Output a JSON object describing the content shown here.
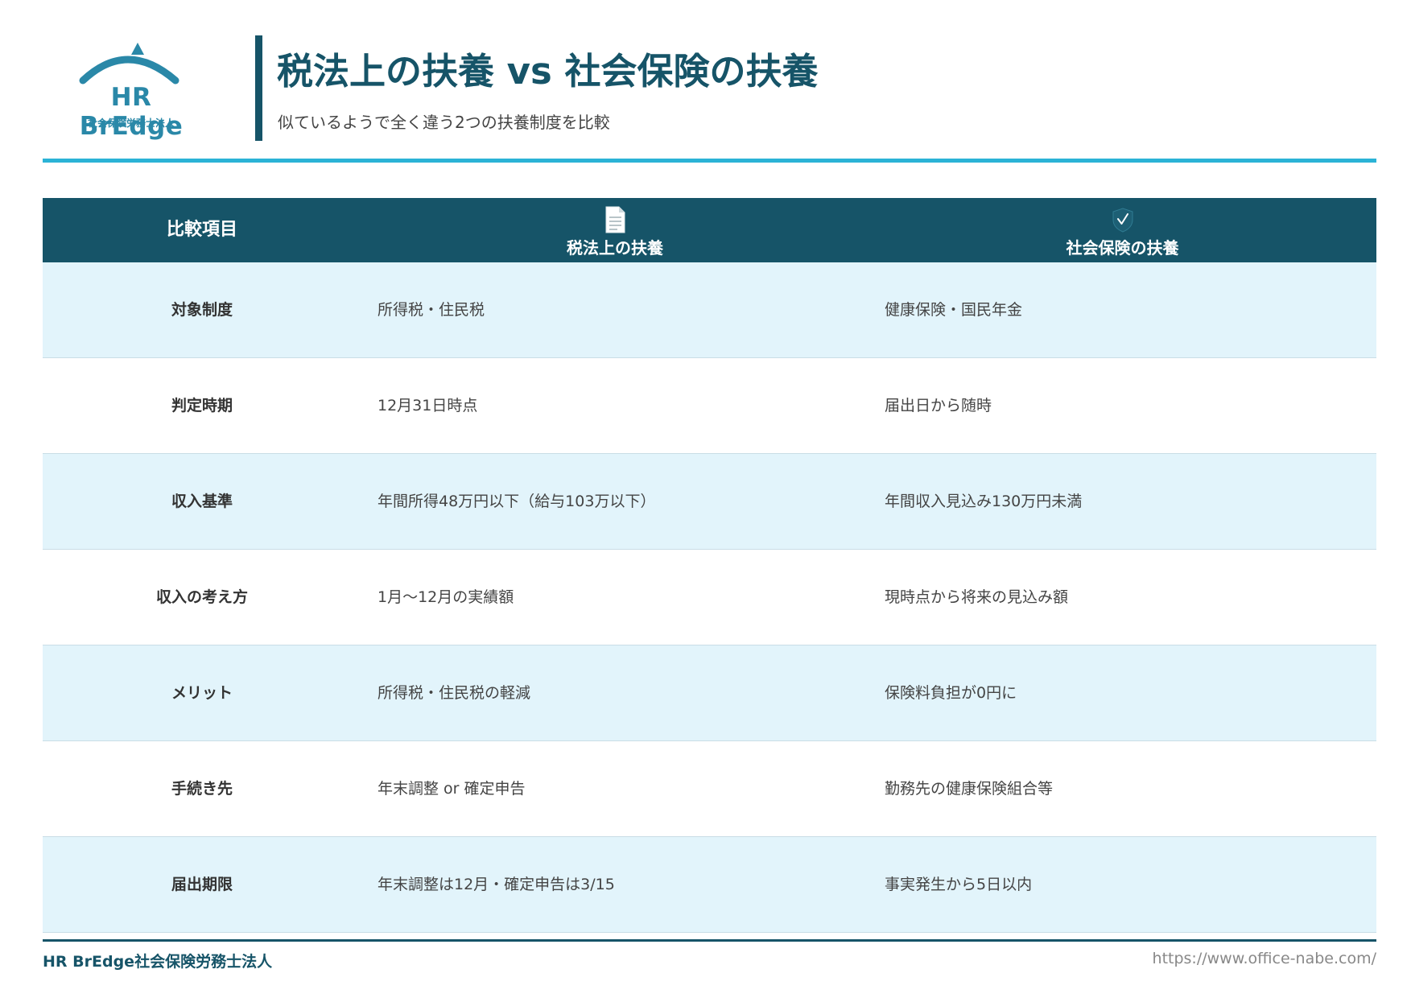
{
  "colors": {
    "primary": "#165468",
    "accent": "#2bb3d6",
    "logo": "#2a88a8",
    "row_alt": "#e2f4fb"
  },
  "logo": {
    "name": "HR BrEdge",
    "subtitle": "社会保険労務士法人"
  },
  "header": {
    "title": "税法上の扶養 vs 社会保険の扶養",
    "subtitle": "似ているようで全く違う2つの扶養制度を比較"
  },
  "table": {
    "headers": {
      "item": "比較項目",
      "tax": "税法上の扶養",
      "tax_icon": "document-icon",
      "social": "社会保険の扶養",
      "social_icon": "shield-check-icon"
    },
    "rows": [
      {
        "item": "対象制度",
        "tax": "所得税・住民税",
        "social": "健康保険・国民年金"
      },
      {
        "item": "判定時期",
        "tax": "12月31日時点",
        "social": "届出日から随時"
      },
      {
        "item": "収入基準",
        "tax": "年間所得48万円以下（給与103万以下）",
        "social": "年間収入見込み130万円未満"
      },
      {
        "item": "収入の考え方",
        "tax": "1月〜12月の実績額",
        "social": "現時点から将来の見込み額"
      },
      {
        "item": "メリット",
        "tax": "所得税・住民税の軽減",
        "social": "保険料負担が0円に"
      },
      {
        "item": "手続き先",
        "tax": "年末調整 or 確定申告",
        "social": "勤務先の健康保険組合等"
      },
      {
        "item": "届出期限",
        "tax": "年末調整は12月・確定申告は3/15",
        "social": "事実発生から5日以内"
      }
    ]
  },
  "footer": {
    "left": "HR BrEdge社会保険労務士法人",
    "right": "https://www.office-nabe.com/"
  }
}
